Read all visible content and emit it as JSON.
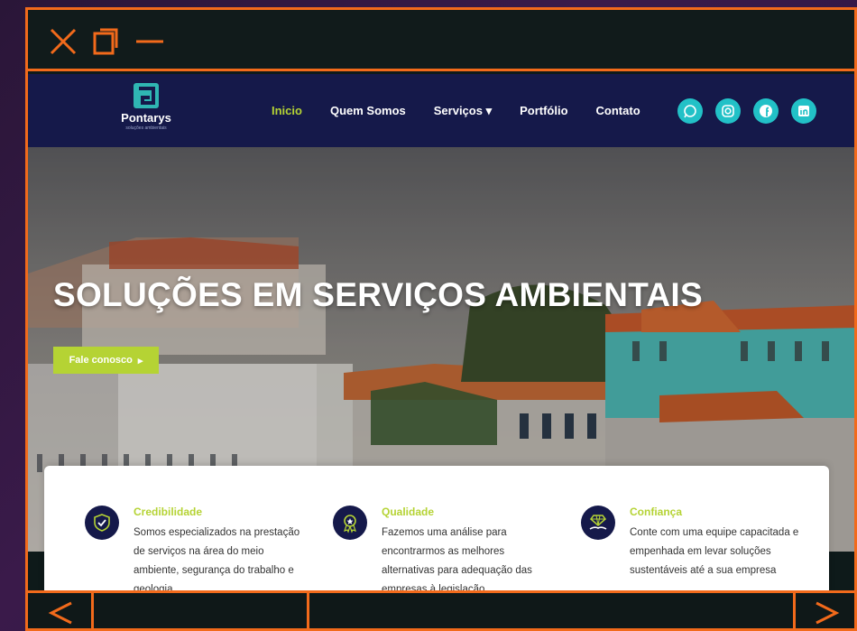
{
  "window": {
    "close_icon": "close-icon",
    "restore_icon": "restore-icon",
    "minimize_icon": "minimize-icon"
  },
  "site": {
    "logo_name": "Pontarys",
    "logo_sub": "soluções ambientais",
    "nav": [
      {
        "label": "Inicio",
        "active": true
      },
      {
        "label": "Quem Somos",
        "active": false
      },
      {
        "label": "Serviços ▾",
        "active": false
      },
      {
        "label": "Portfólio",
        "active": false
      },
      {
        "label": "Contato",
        "active": false
      }
    ],
    "socials": [
      "whatsapp-icon",
      "instagram-icon",
      "facebook-icon",
      "linkedin-icon"
    ],
    "accent": "#b5d334",
    "nav_bg": "#15194a",
    "social_color": "#22c1c7"
  },
  "hero": {
    "title": "SOLUÇÕES EM SERVIÇOS AMBIENTAIS",
    "button": "Fale conosco",
    "button_arrow": "▸"
  },
  "features": [
    {
      "icon": "shield-check-icon",
      "title": "Credibilidade",
      "text": "Somos especializados na prestação de serviços na área do meio ambiente, segurança do trabalho e geologia"
    },
    {
      "icon": "medal-icon",
      "title": "Qualidade",
      "text": "Fazemos uma análise para encontrarmos as melhores alternativas para adequação das empresas à legislação"
    },
    {
      "icon": "diamond-hand-icon",
      "title": "Confiança",
      "text": "Conte com uma equipe capacitada e empenhada em levar soluções sustentáveis até a sua empresa"
    }
  ],
  "bottom": {
    "prev_icon": "chevron-left-icon",
    "next_icon": "chevron-right-icon"
  },
  "frame_color": "#f26a1b"
}
